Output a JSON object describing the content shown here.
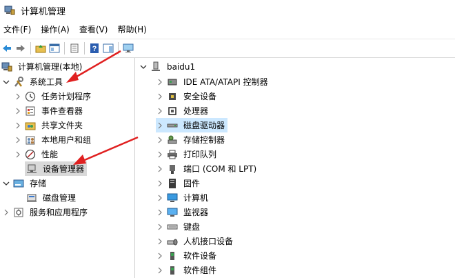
{
  "window": {
    "title": "计算机管理"
  },
  "menu": [
    "文件(F)",
    "操作(A)",
    "查看(V)",
    "帮助(H)"
  ],
  "toolbar": {
    "buttons": [
      "back-arrow-icon",
      "forward-arrow-icon",
      "up-folder-icon",
      "show-hide-tree-icon",
      "properties-icon",
      "help-icon",
      "action-pane-icon",
      "monitor-icon"
    ]
  },
  "tree": {
    "root": "计算机管理(本地)",
    "system_tools": "系统工具",
    "task_scheduler": "任务计划程序",
    "event_viewer": "事件查看器",
    "shared_folders": "共享文件夹",
    "local_users": "本地用户和组",
    "performance": "性能",
    "device_manager": "设备管理器",
    "storage": "存储",
    "disk_management": "磁盘管理",
    "services_apps": "服务和应用程序"
  },
  "devices": {
    "computer_name": "baidu1",
    "items": [
      "IDE ATA/ATAPI 控制器",
      "安全设备",
      "处理器",
      "磁盘驱动器",
      "存储控制器",
      "打印队列",
      "端口 (COM 和 LPT)",
      "固件",
      "计算机",
      "监视器",
      "键盘",
      "人机接口设备",
      "软件设备",
      "软件组件"
    ]
  },
  "colors": {
    "selection": "#cce8ff",
    "arrow": "#e02020"
  }
}
